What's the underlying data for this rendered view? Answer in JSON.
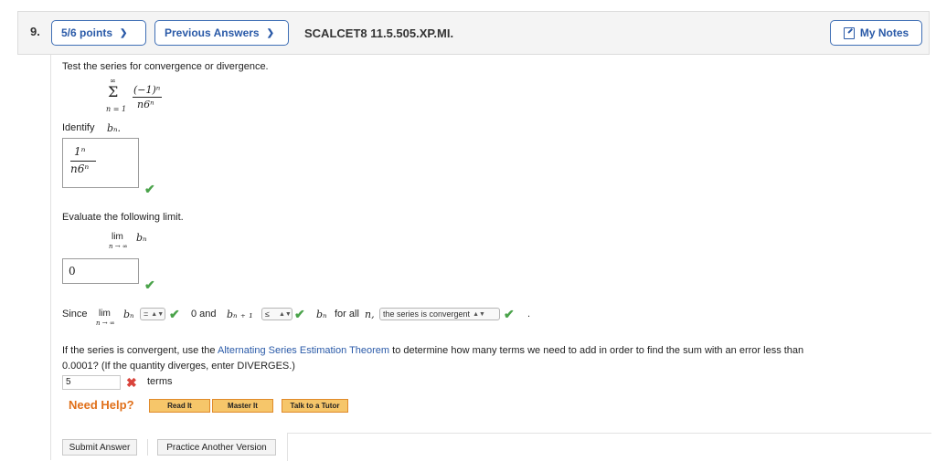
{
  "question": {
    "number": "9.",
    "points": "5/6 points",
    "previous_answers": "Previous Answers",
    "id": "SCALCET8 11.5.505.XP.MI.",
    "my_notes": "My Notes"
  },
  "body": {
    "prompt": "Test the series for convergence or divergence.",
    "series": {
      "sigma_top": "∞",
      "sigma_bottom": "n = 1",
      "numerator": "(−1)ⁿ",
      "denominator": "n6ⁿ"
    },
    "identify_label": "Identify",
    "identify_var": "bₙ.",
    "answer1": {
      "numerator": "1ⁿ",
      "denominator": "n6ⁿ"
    },
    "evaluate_label": "Evaluate the following limit.",
    "limit_expr": {
      "lim": "lim",
      "var": "bₙ",
      "sub": "n → ∞"
    },
    "answer2": "0",
    "since_row": {
      "since": "Since",
      "lim": "lim",
      "bn": "bₙ",
      "sub": "n → ∞",
      "select1": "=",
      "zero_and": "0 and",
      "bn1": "bₙ ₊ ₁",
      "select2": "≤",
      "bn2": "bₙ",
      "for_all": "for all",
      "n": "n,",
      "select3": "the series is convergent",
      "period": "."
    },
    "estimation": {
      "line1_pre": "If the series is convergent, use the ",
      "link": "Alternating Series Estimation Theorem",
      "line1_post": " to determine how many terms we need to add in order to find the sum with an error less than",
      "line2": "0.0001? (If the quantity diverges, enter DIVERGES.)",
      "answer": "5",
      "unit": "terms"
    }
  },
  "help": {
    "need_help": "Need Help?",
    "read_it": "Read It",
    "master_it": "Master It",
    "talk_tutor": "Talk to a Tutor"
  },
  "footer": {
    "submit": "Submit Answer",
    "practice": "Practice Another Version"
  },
  "colors": {
    "accent": "#2a5aa8",
    "correct": "#4aa34a",
    "incorrect": "#d9433b",
    "help": "#e0701a"
  }
}
